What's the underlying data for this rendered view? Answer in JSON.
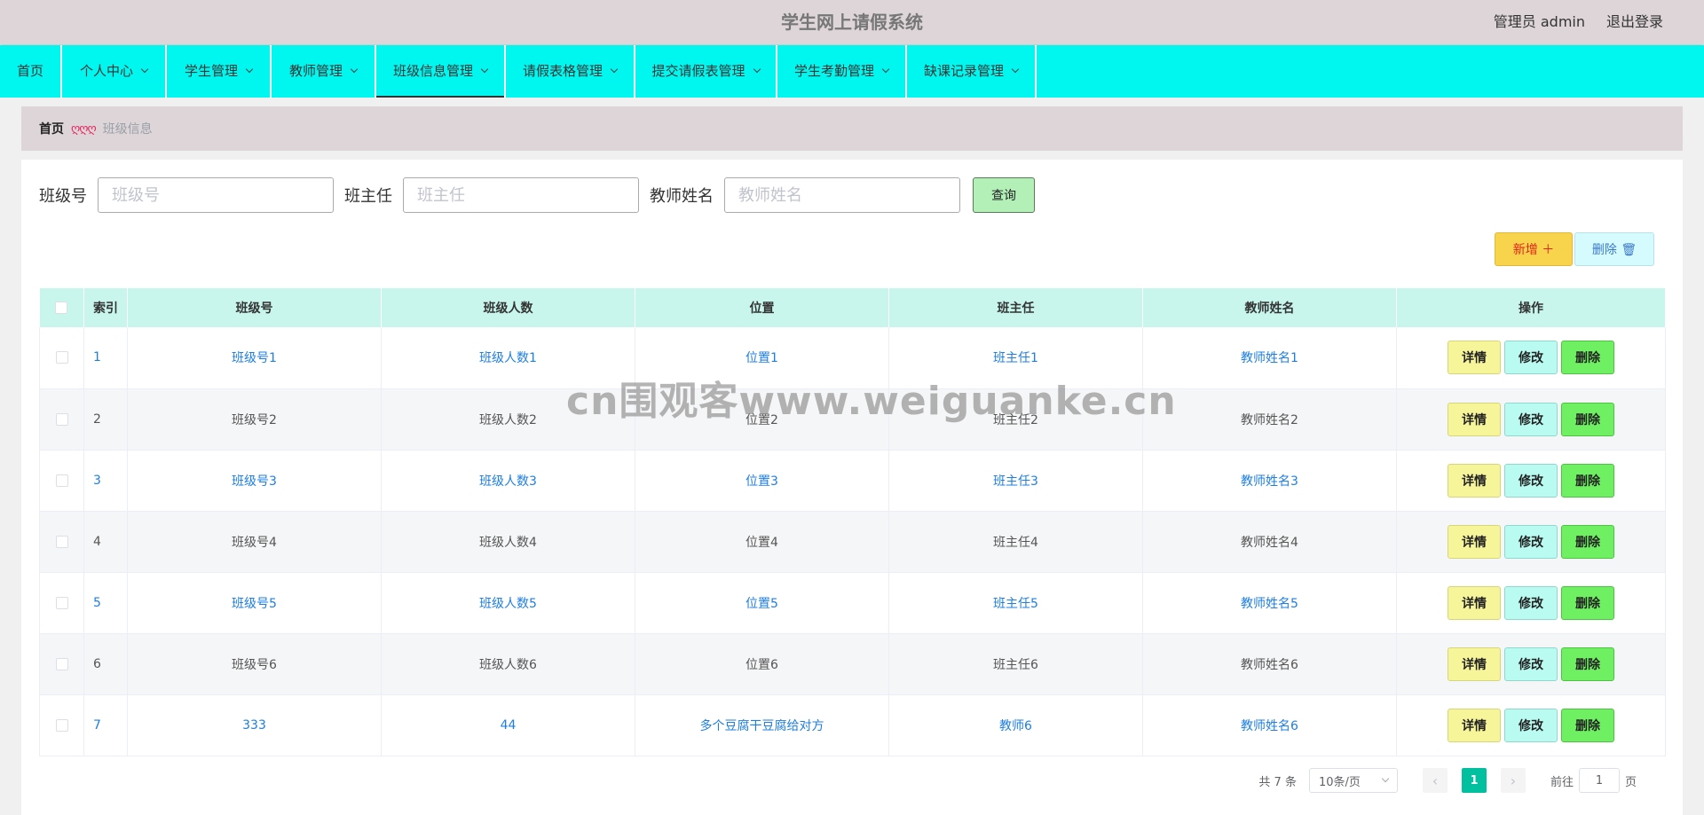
{
  "header": {
    "title": "学生网上请假系统",
    "user_label": "管理员 admin",
    "logout_label": "退出登录"
  },
  "nav": {
    "items": [
      {
        "label": "首页",
        "width": 70,
        "chevron": false,
        "active": false
      },
      {
        "label": "个人中心",
        "width": 118,
        "chevron": true,
        "active": false
      },
      {
        "label": "学生管理",
        "width": 118,
        "chevron": true,
        "active": false
      },
      {
        "label": "教师管理",
        "width": 118,
        "chevron": true,
        "active": false
      },
      {
        "label": "班级信息管理",
        "width": 146,
        "chevron": true,
        "active": true
      },
      {
        "label": "请假表格管理",
        "width": 146,
        "chevron": true,
        "active": false
      },
      {
        "label": "提交请假表管理",
        "width": 160,
        "chevron": true,
        "active": false
      },
      {
        "label": "学生考勤管理",
        "width": 146,
        "chevron": true,
        "active": false
      },
      {
        "label": "缺课记录管理",
        "width": 146,
        "chevron": true,
        "active": false
      }
    ]
  },
  "breadcrumb": {
    "home": "首页",
    "separator": "ღღღ",
    "current": "班级信息"
  },
  "search": {
    "class_no_label": "班级号",
    "class_no_placeholder": "班级号",
    "head_teacher_label": "班主任",
    "head_teacher_placeholder": "班主任",
    "teacher_name_label": "教师姓名",
    "teacher_name_placeholder": "教师姓名",
    "query_label": "查询"
  },
  "actions": {
    "add_label": "新增 ＋",
    "delete_label": "删除 🗑"
  },
  "table": {
    "headers": [
      "索引",
      "班级号",
      "班级人数",
      "位置",
      "班主任",
      "教师姓名",
      "操作"
    ],
    "rows": [
      {
        "idx": "1",
        "class_no": "班级号1",
        "count": "班级人数1",
        "location": "位置1",
        "head": "班主任1",
        "teacher": "教师姓名1"
      },
      {
        "idx": "2",
        "class_no": "班级号2",
        "count": "班级人数2",
        "location": "位置2",
        "head": "班主任2",
        "teacher": "教师姓名2"
      },
      {
        "idx": "3",
        "class_no": "班级号3",
        "count": "班级人数3",
        "location": "位置3",
        "head": "班主任3",
        "teacher": "教师姓名3"
      },
      {
        "idx": "4",
        "class_no": "班级号4",
        "count": "班级人数4",
        "location": "位置4",
        "head": "班主任4",
        "teacher": "教师姓名4"
      },
      {
        "idx": "5",
        "class_no": "班级号5",
        "count": "班级人数5",
        "location": "位置5",
        "head": "班主任5",
        "teacher": "教师姓名5"
      },
      {
        "idx": "6",
        "class_no": "班级号6",
        "count": "班级人数6",
        "location": "位置6",
        "head": "班主任6",
        "teacher": "教师姓名6"
      },
      {
        "idx": "7",
        "class_no": "333",
        "count": "44",
        "location": "多个豆腐干豆腐给对方",
        "head": "教师6",
        "teacher": "教师姓名6"
      }
    ],
    "op_labels": {
      "detail": "详情",
      "edit": "修改",
      "delete": "删除"
    }
  },
  "pagination": {
    "total": "共 7 条",
    "page_size": "10条/页",
    "current_page": "1",
    "goto_prefix": "前往",
    "goto_value": "1",
    "goto_suffix": "页"
  },
  "watermark": "cn围观客www.weiguanke.cn",
  "colors": {
    "header_bg": "#ddd5d7",
    "nav_bg": "#00f7ef",
    "table_header_bg": "#c8f6ec",
    "link_blue": "#1e7fe0",
    "page_active": "#00c0a0"
  }
}
